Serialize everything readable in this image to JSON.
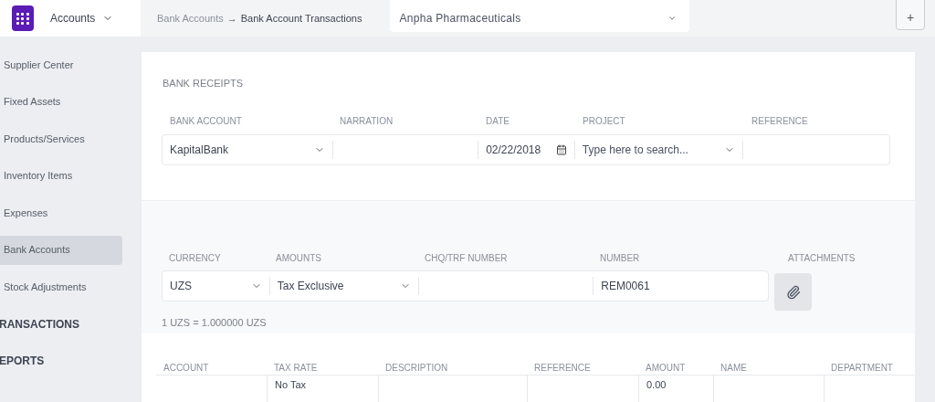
{
  "header": {
    "module_menu": {
      "label": "Accounts"
    },
    "breadcrumb": {
      "parent": "Bank Accounts",
      "separator": "→",
      "current": "Bank Account Transactions"
    },
    "company_select": {
      "value": "Anpha Pharmaceuticals"
    },
    "add_button": {
      "label": "+"
    }
  },
  "sidebar": {
    "items": [
      {
        "kind": "link",
        "label": "Supplier Center",
        "selected": false
      },
      {
        "kind": "link",
        "label": "Fixed Assets",
        "selected": false
      },
      {
        "kind": "link",
        "label": "Products/Services",
        "selected": false
      },
      {
        "kind": "link",
        "label": "Inventory Items",
        "selected": false
      },
      {
        "kind": "link",
        "label": "Expenses",
        "selected": false
      },
      {
        "kind": "link",
        "label": "Bank Accounts",
        "selected": true
      },
      {
        "kind": "link",
        "label": "Stock Adjustments",
        "selected": false
      },
      {
        "kind": "section",
        "label": "RANSACTIONS",
        "selected": false
      },
      {
        "kind": "section",
        "label": "EPORTS",
        "selected": false
      }
    ]
  },
  "form": {
    "title": "BANK RECEIPTS",
    "details": [
      {
        "kind": "select",
        "label": "BANK ACCOUNT",
        "value": "KapitalBank"
      },
      {
        "kind": "text",
        "label": "NARRATION"
      },
      {
        "kind": "date",
        "label": "DATE",
        "value": "02/22/2018"
      },
      {
        "kind": "select",
        "label": "PROJECT",
        "placeholder": "Type here to search..."
      },
      {
        "kind": "text",
        "label": "REFERENCE"
      }
    ],
    "options": [
      {
        "kind": "select",
        "label": "CURRENCY",
        "value": "UZS"
      },
      {
        "kind": "select",
        "label": "AMOUNTS",
        "value": "Tax Exclusive"
      },
      {
        "kind": "text",
        "label": "CHQ/TRF NUMBER"
      },
      {
        "kind": "text",
        "label": "NUMBER",
        "value": "REM0061"
      }
    ],
    "attachments": {
      "label": "ATTACHMENTS"
    },
    "exchange_rate": "1 UZS = 1.000000 UZS"
  },
  "table": {
    "columns": [
      "ACCOUNT",
      "TAX RATE",
      "DESCRIPTION",
      "REFERENCE",
      "AMOUNT",
      "NAME",
      "DEPARTMENT"
    ],
    "rows": [
      {
        "cells": [
          "",
          "No Tax",
          "",
          "",
          "0.00",
          "",
          ""
        ]
      }
    ]
  }
}
